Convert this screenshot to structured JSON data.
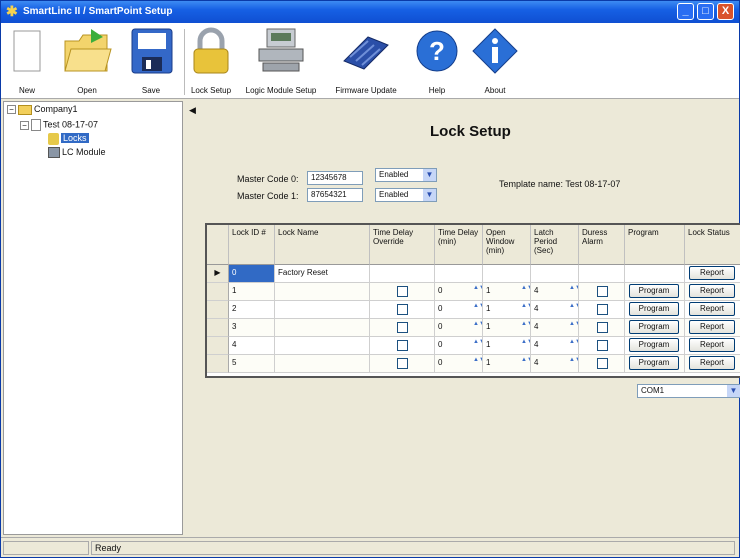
{
  "window": {
    "title": "SmartLinc II / SmartPoint Setup",
    "controls": {
      "minimize": "_",
      "maximize": "□",
      "close": "X"
    }
  },
  "toolbar": {
    "items": [
      {
        "label": "New",
        "icon": "new-document-icon"
      },
      {
        "label": "Open",
        "icon": "open-folder-icon"
      },
      {
        "label": "Save",
        "icon": "save-disk-icon"
      },
      {
        "label": "Lock Setup",
        "icon": "padlock-icon"
      },
      {
        "label": "Logic Module Setup",
        "icon": "logic-module-icon"
      },
      {
        "label": "Firmware Update",
        "icon": "chip-icon"
      },
      {
        "label": "Help",
        "icon": "help-icon"
      },
      {
        "label": "About",
        "icon": "about-icon"
      }
    ]
  },
  "tree": {
    "root": "Company1",
    "child": "Test 08-17-07",
    "locks": "Locks",
    "module": "LC Module"
  },
  "main": {
    "collapse_arrow": "◀",
    "title": "Lock Setup",
    "master_code_0_label": "Master Code 0:",
    "master_code_0_value": "12345678",
    "master_code_0_state": "Enabled",
    "master_code_1_label": "Master Code 1:",
    "master_code_1_value": "87654321",
    "master_code_1_state": "Enabled",
    "template_label": "Template name: Test 08-17-07"
  },
  "grid": {
    "headers": [
      "Lock ID #",
      "Lock Name",
      "Time Delay Override",
      "Time Delay (min)",
      "Open Window (min)",
      "Latch Period (Sec)",
      "Duress Alarm",
      "Program",
      "Lock Status"
    ],
    "rows": [
      {
        "id": "0",
        "name": "Factory Reset",
        "delay": "",
        "window": "",
        "latch": "",
        "program": "",
        "status": "Report",
        "current": true
      },
      {
        "id": "1",
        "name": "",
        "delay": "0",
        "window": "1",
        "latch": "4",
        "program": "Program",
        "status": "Report"
      },
      {
        "id": "2",
        "name": "",
        "delay": "0",
        "window": "1",
        "latch": "4",
        "program": "Program",
        "status": "Report"
      },
      {
        "id": "3",
        "name": "",
        "delay": "0",
        "window": "1",
        "latch": "4",
        "program": "Program",
        "status": "Report"
      },
      {
        "id": "4",
        "name": "",
        "delay": "0",
        "window": "1",
        "latch": "4",
        "program": "Program",
        "status": "Report"
      },
      {
        "id": "5",
        "name": "",
        "delay": "0",
        "window": "1",
        "latch": "4",
        "program": "Program",
        "status": "Report"
      }
    ],
    "current_row_marker": "▶"
  },
  "port": {
    "value": "COM1"
  },
  "status": {
    "text": "Ready"
  }
}
